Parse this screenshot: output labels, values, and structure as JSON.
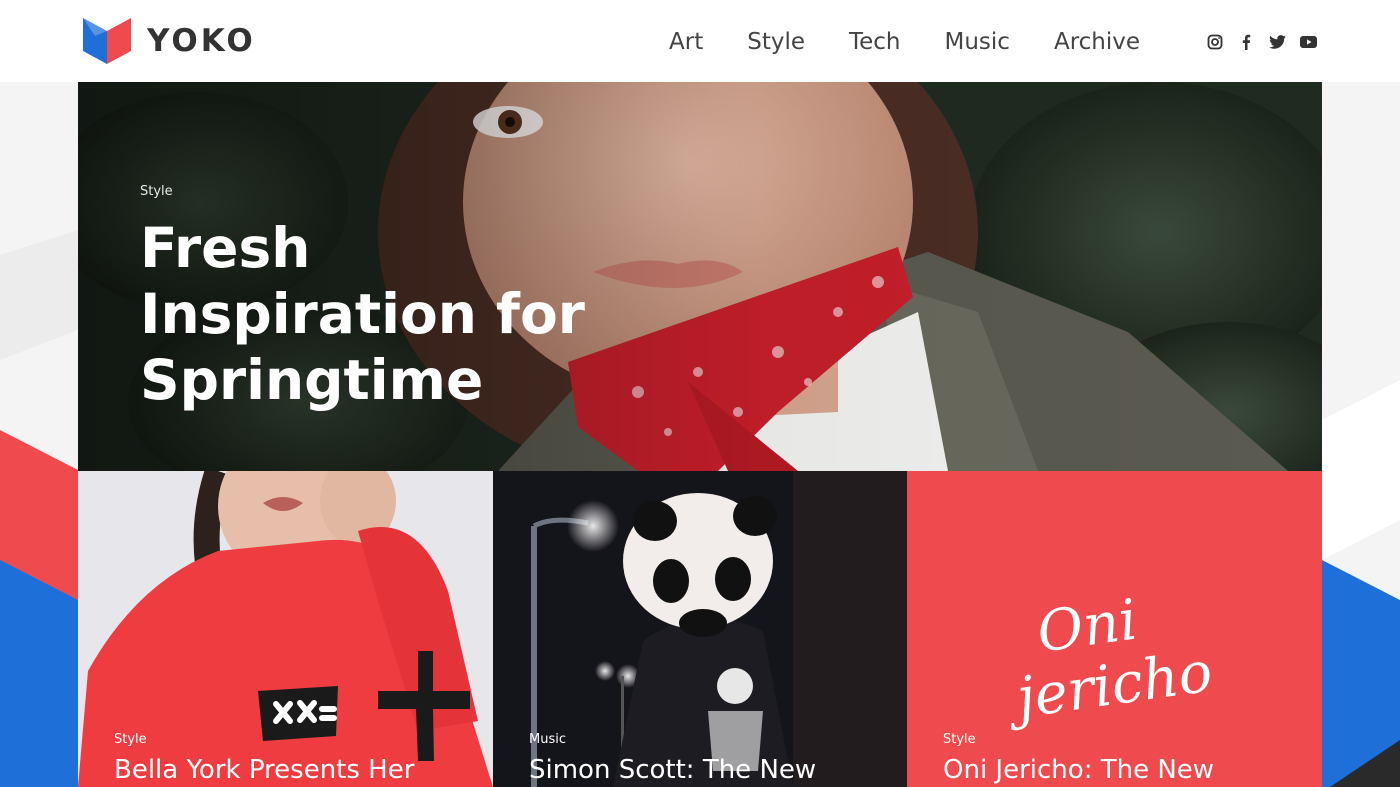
{
  "brand": {
    "name": "YOKO"
  },
  "nav": {
    "items": [
      {
        "label": "Art"
      },
      {
        "label": "Style"
      },
      {
        "label": "Tech"
      },
      {
        "label": "Music"
      },
      {
        "label": "Archive"
      }
    ]
  },
  "social": [
    "instagram-icon",
    "facebook-icon",
    "twitter-icon",
    "youtube-icon"
  ],
  "hero": {
    "category": "Style",
    "title": "Fresh Inspiration for Springtime"
  },
  "cards": [
    {
      "category": "Style",
      "title": "Bella York Presents Her"
    },
    {
      "category": "Music",
      "title": "Simon Scott: The New"
    },
    {
      "category": "Style",
      "title": "Oni Jericho: The New",
      "logo_text": "Oni jericho"
    }
  ],
  "colors": {
    "accent_red": "#ef4b4f",
    "accent_blue": "#1f6fd8",
    "text_dark": "#333333"
  }
}
